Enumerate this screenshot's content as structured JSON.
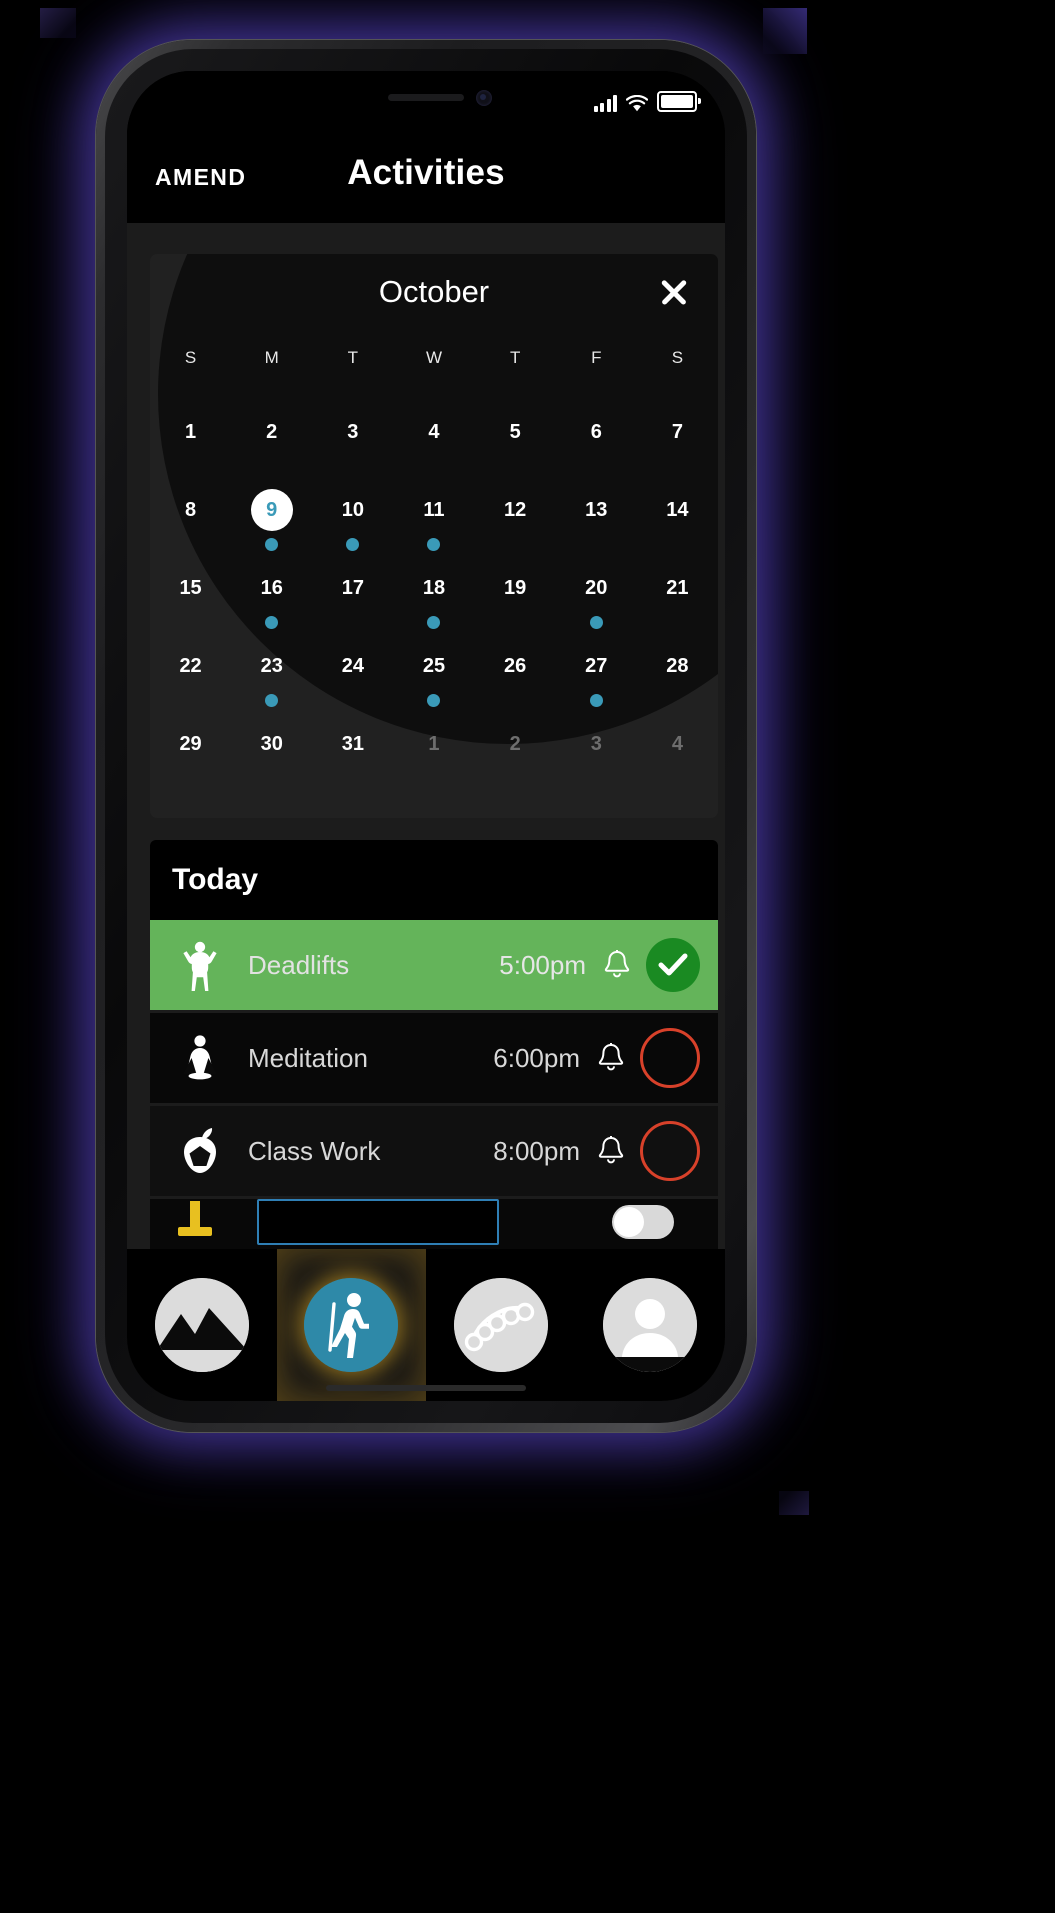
{
  "statusbar": {
    "signal_icon": "cellular-bars-icon",
    "wifi_icon": "wifi-icon",
    "battery_icon": "battery-full-icon"
  },
  "header": {
    "brand": "AMEND",
    "title": "Activities"
  },
  "calendar": {
    "month": "October",
    "close_label": "✕",
    "weekdays": [
      "S",
      "M",
      "T",
      "W",
      "T",
      "F",
      "S"
    ],
    "selected_day": 9,
    "accent_color": "#3a9ab8",
    "weeks": [
      [
        {
          "n": "1",
          "muted": false,
          "dot": false
        },
        {
          "n": "2",
          "muted": false,
          "dot": false
        },
        {
          "n": "3",
          "muted": false,
          "dot": false
        },
        {
          "n": "4",
          "muted": false,
          "dot": false
        },
        {
          "n": "5",
          "muted": false,
          "dot": false
        },
        {
          "n": "6",
          "muted": false,
          "dot": false
        },
        {
          "n": "7",
          "muted": false,
          "dot": false
        }
      ],
      [
        {
          "n": "8",
          "muted": false,
          "dot": false
        },
        {
          "n": "9",
          "muted": false,
          "dot": true,
          "selected": true
        },
        {
          "n": "10",
          "muted": false,
          "dot": true
        },
        {
          "n": "11",
          "muted": false,
          "dot": true
        },
        {
          "n": "12",
          "muted": false,
          "dot": false
        },
        {
          "n": "13",
          "muted": false,
          "dot": false
        },
        {
          "n": "14",
          "muted": false,
          "dot": false
        }
      ],
      [
        {
          "n": "15",
          "muted": false,
          "dot": false
        },
        {
          "n": "16",
          "muted": false,
          "dot": true
        },
        {
          "n": "17",
          "muted": false,
          "dot": false
        },
        {
          "n": "18",
          "muted": false,
          "dot": true
        },
        {
          "n": "19",
          "muted": false,
          "dot": false
        },
        {
          "n": "20",
          "muted": false,
          "dot": true
        },
        {
          "n": "21",
          "muted": false,
          "dot": false
        }
      ],
      [
        {
          "n": "22",
          "muted": false,
          "dot": false
        },
        {
          "n": "23",
          "muted": false,
          "dot": true
        },
        {
          "n": "24",
          "muted": false,
          "dot": false
        },
        {
          "n": "25",
          "muted": false,
          "dot": true
        },
        {
          "n": "26",
          "muted": false,
          "dot": false
        },
        {
          "n": "27",
          "muted": false,
          "dot": true
        },
        {
          "n": "28",
          "muted": false,
          "dot": false
        }
      ],
      [
        {
          "n": "29",
          "muted": false,
          "dot": false
        },
        {
          "n": "30",
          "muted": false,
          "dot": false
        },
        {
          "n": "31",
          "muted": false,
          "dot": false
        },
        {
          "n": "1",
          "muted": true,
          "dot": false
        },
        {
          "n": "2",
          "muted": true,
          "dot": false
        },
        {
          "n": "3",
          "muted": true,
          "dot": false
        },
        {
          "n": "4",
          "muted": true,
          "dot": false
        }
      ]
    ]
  },
  "today": {
    "heading": "Today",
    "activities": [
      {
        "name": "Deadlifts",
        "time": "5:00pm",
        "icon": "bodybuilder-icon",
        "bell_icon": "bell-icon",
        "state": "done",
        "row_color": "#64b45a",
        "status_color": "#1a8a22"
      },
      {
        "name": "Meditation",
        "time": "6:00pm",
        "icon": "meditation-icon",
        "bell_icon": "bell-icon",
        "state": "todo",
        "row_color": "#080808",
        "status_color": "#d8412a"
      },
      {
        "name": "Class Work",
        "time": "8:00pm",
        "icon": "apple-book-icon",
        "bell_icon": "bell-icon",
        "state": "todo",
        "row_color": "#101010",
        "status_color": "#d8412a"
      }
    ],
    "new_activity_row": {
      "icon": "yellow-tool-icon",
      "input_value": "",
      "input_placeholder": "",
      "toggle_icon": "toggle-switch-icon"
    }
  },
  "tabbar": {
    "items": [
      {
        "icon": "mountain-icon",
        "active": false
      },
      {
        "icon": "hiker-icon",
        "active": true
      },
      {
        "icon": "beads-icon",
        "active": false
      },
      {
        "icon": "profile-avatar-icon",
        "active": false
      }
    ]
  }
}
